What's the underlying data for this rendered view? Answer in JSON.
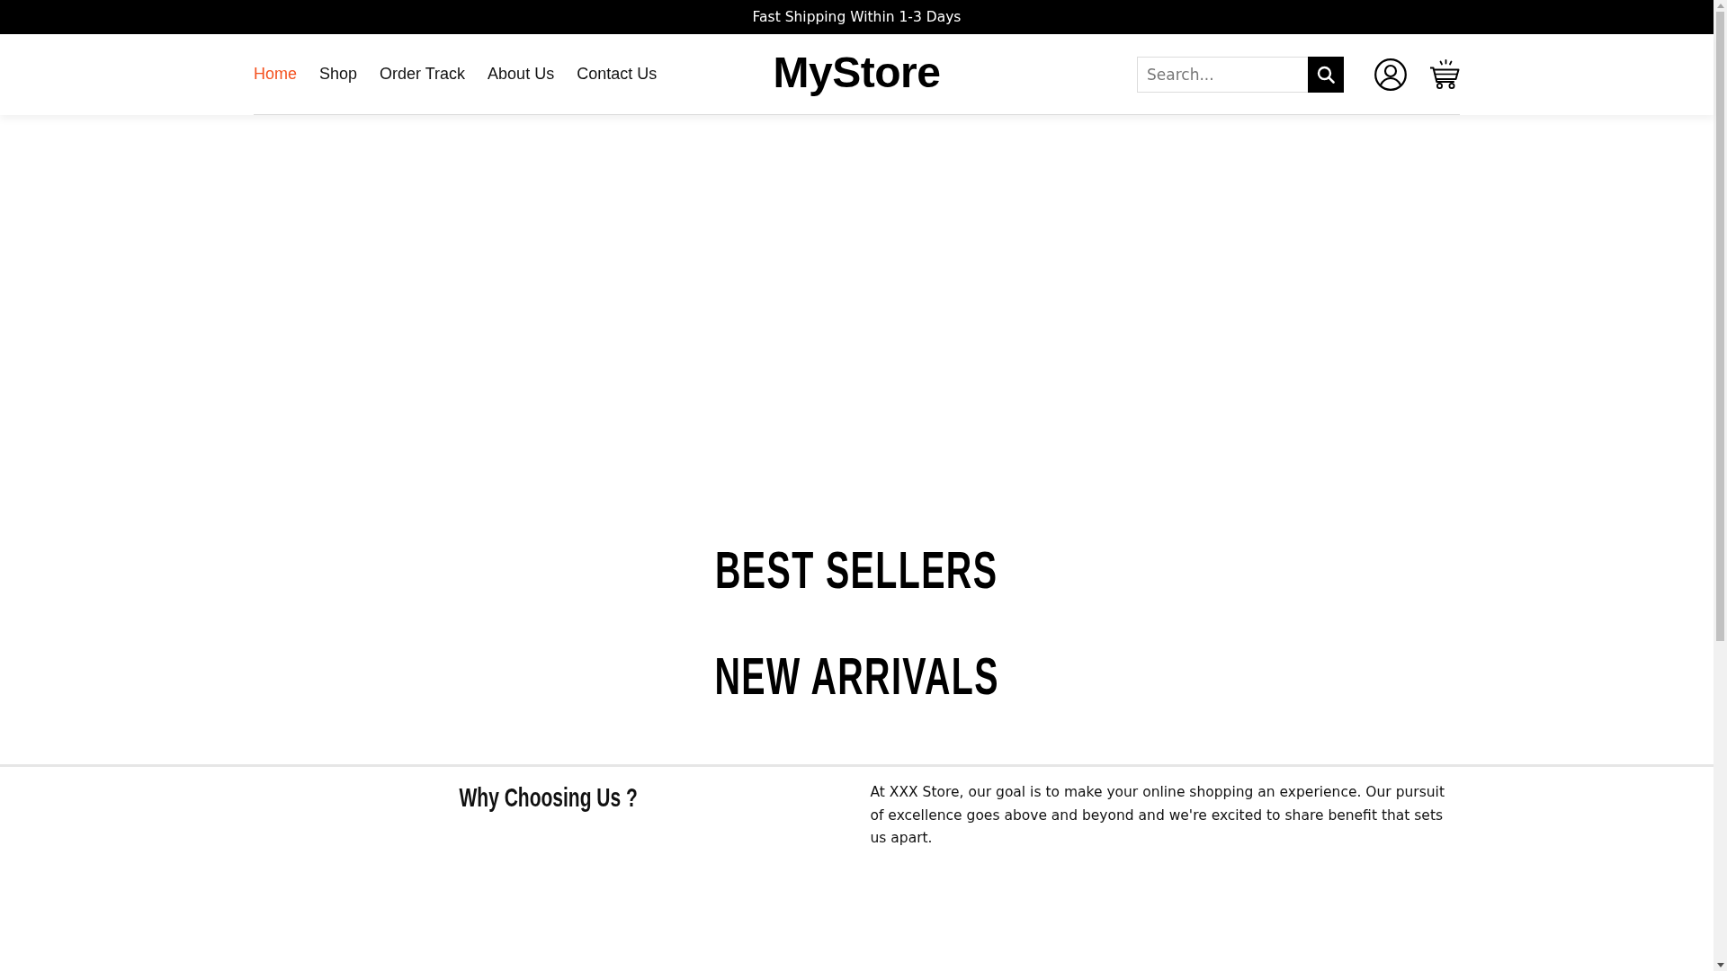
{
  "announcement_bar": {
    "text": "Fast Shipping Within 1-3 Days"
  },
  "header": {
    "nav": [
      {
        "label": "Home",
        "selected": true
      },
      {
        "label": "Shop",
        "selected": false
      },
      {
        "label": "Order Track",
        "selected": false
      },
      {
        "label": "About Us",
        "selected": false
      },
      {
        "label": "Contact Us",
        "selected": false
      }
    ],
    "logo": "MyStore",
    "search": {
      "placeholder": "Search..."
    }
  },
  "sections": [
    {
      "title": "BEST SELLERS"
    },
    {
      "title": "NEW ARRIVALS"
    }
  ],
  "why_choose_us": {
    "title": "Why Choosing Us ?",
    "text": "At XXX Store, our goal is to make your online shopping an experience. Our pursuit of excellence goes above and beyond and we're excited to share benefit that sets us apart."
  }
}
